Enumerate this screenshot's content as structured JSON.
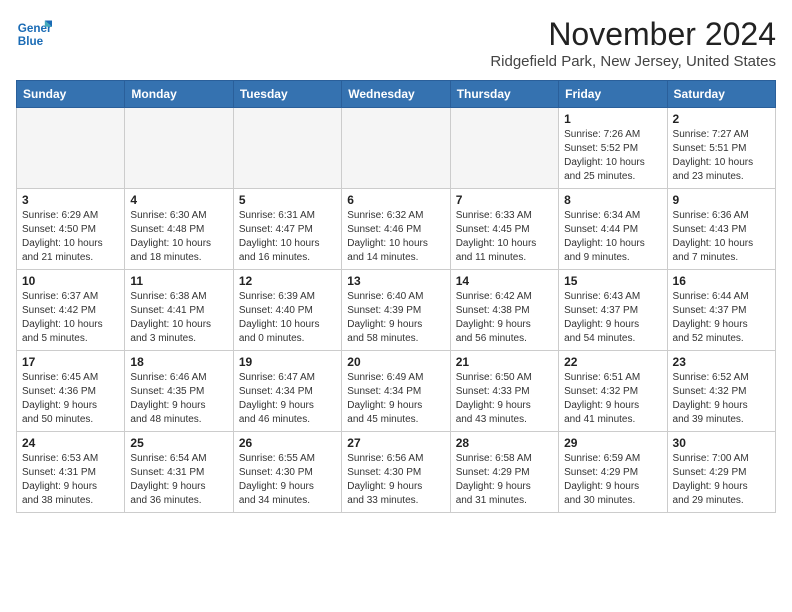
{
  "logo": {
    "line1": "General",
    "line2": "Blue"
  },
  "title": "November 2024",
  "subtitle": "Ridgefield Park, New Jersey, United States",
  "weekdays": [
    "Sunday",
    "Monday",
    "Tuesday",
    "Wednesday",
    "Thursday",
    "Friday",
    "Saturday"
  ],
  "weeks": [
    [
      {
        "day": "",
        "info": ""
      },
      {
        "day": "",
        "info": ""
      },
      {
        "day": "",
        "info": ""
      },
      {
        "day": "",
        "info": ""
      },
      {
        "day": "",
        "info": ""
      },
      {
        "day": "1",
        "info": "Sunrise: 7:26 AM\nSunset: 5:52 PM\nDaylight: 10 hours\nand 25 minutes."
      },
      {
        "day": "2",
        "info": "Sunrise: 7:27 AM\nSunset: 5:51 PM\nDaylight: 10 hours\nand 23 minutes."
      }
    ],
    [
      {
        "day": "3",
        "info": "Sunrise: 6:29 AM\nSunset: 4:50 PM\nDaylight: 10 hours\nand 21 minutes."
      },
      {
        "day": "4",
        "info": "Sunrise: 6:30 AM\nSunset: 4:48 PM\nDaylight: 10 hours\nand 18 minutes."
      },
      {
        "day": "5",
        "info": "Sunrise: 6:31 AM\nSunset: 4:47 PM\nDaylight: 10 hours\nand 16 minutes."
      },
      {
        "day": "6",
        "info": "Sunrise: 6:32 AM\nSunset: 4:46 PM\nDaylight: 10 hours\nand 14 minutes."
      },
      {
        "day": "7",
        "info": "Sunrise: 6:33 AM\nSunset: 4:45 PM\nDaylight: 10 hours\nand 11 minutes."
      },
      {
        "day": "8",
        "info": "Sunrise: 6:34 AM\nSunset: 4:44 PM\nDaylight: 10 hours\nand 9 minutes."
      },
      {
        "day": "9",
        "info": "Sunrise: 6:36 AM\nSunset: 4:43 PM\nDaylight: 10 hours\nand 7 minutes."
      }
    ],
    [
      {
        "day": "10",
        "info": "Sunrise: 6:37 AM\nSunset: 4:42 PM\nDaylight: 10 hours\nand 5 minutes."
      },
      {
        "day": "11",
        "info": "Sunrise: 6:38 AM\nSunset: 4:41 PM\nDaylight: 10 hours\nand 3 minutes."
      },
      {
        "day": "12",
        "info": "Sunrise: 6:39 AM\nSunset: 4:40 PM\nDaylight: 10 hours\nand 0 minutes."
      },
      {
        "day": "13",
        "info": "Sunrise: 6:40 AM\nSunset: 4:39 PM\nDaylight: 9 hours\nand 58 minutes."
      },
      {
        "day": "14",
        "info": "Sunrise: 6:42 AM\nSunset: 4:38 PM\nDaylight: 9 hours\nand 56 minutes."
      },
      {
        "day": "15",
        "info": "Sunrise: 6:43 AM\nSunset: 4:37 PM\nDaylight: 9 hours\nand 54 minutes."
      },
      {
        "day": "16",
        "info": "Sunrise: 6:44 AM\nSunset: 4:37 PM\nDaylight: 9 hours\nand 52 minutes."
      }
    ],
    [
      {
        "day": "17",
        "info": "Sunrise: 6:45 AM\nSunset: 4:36 PM\nDaylight: 9 hours\nand 50 minutes."
      },
      {
        "day": "18",
        "info": "Sunrise: 6:46 AM\nSunset: 4:35 PM\nDaylight: 9 hours\nand 48 minutes."
      },
      {
        "day": "19",
        "info": "Sunrise: 6:47 AM\nSunset: 4:34 PM\nDaylight: 9 hours\nand 46 minutes."
      },
      {
        "day": "20",
        "info": "Sunrise: 6:49 AM\nSunset: 4:34 PM\nDaylight: 9 hours\nand 45 minutes."
      },
      {
        "day": "21",
        "info": "Sunrise: 6:50 AM\nSunset: 4:33 PM\nDaylight: 9 hours\nand 43 minutes."
      },
      {
        "day": "22",
        "info": "Sunrise: 6:51 AM\nSunset: 4:32 PM\nDaylight: 9 hours\nand 41 minutes."
      },
      {
        "day": "23",
        "info": "Sunrise: 6:52 AM\nSunset: 4:32 PM\nDaylight: 9 hours\nand 39 minutes."
      }
    ],
    [
      {
        "day": "24",
        "info": "Sunrise: 6:53 AM\nSunset: 4:31 PM\nDaylight: 9 hours\nand 38 minutes."
      },
      {
        "day": "25",
        "info": "Sunrise: 6:54 AM\nSunset: 4:31 PM\nDaylight: 9 hours\nand 36 minutes."
      },
      {
        "day": "26",
        "info": "Sunrise: 6:55 AM\nSunset: 4:30 PM\nDaylight: 9 hours\nand 34 minutes."
      },
      {
        "day": "27",
        "info": "Sunrise: 6:56 AM\nSunset: 4:30 PM\nDaylight: 9 hours\nand 33 minutes."
      },
      {
        "day": "28",
        "info": "Sunrise: 6:58 AM\nSunset: 4:29 PM\nDaylight: 9 hours\nand 31 minutes."
      },
      {
        "day": "29",
        "info": "Sunrise: 6:59 AM\nSunset: 4:29 PM\nDaylight: 9 hours\nand 30 minutes."
      },
      {
        "day": "30",
        "info": "Sunrise: 7:00 AM\nSunset: 4:29 PM\nDaylight: 9 hours\nand 29 minutes."
      }
    ]
  ]
}
